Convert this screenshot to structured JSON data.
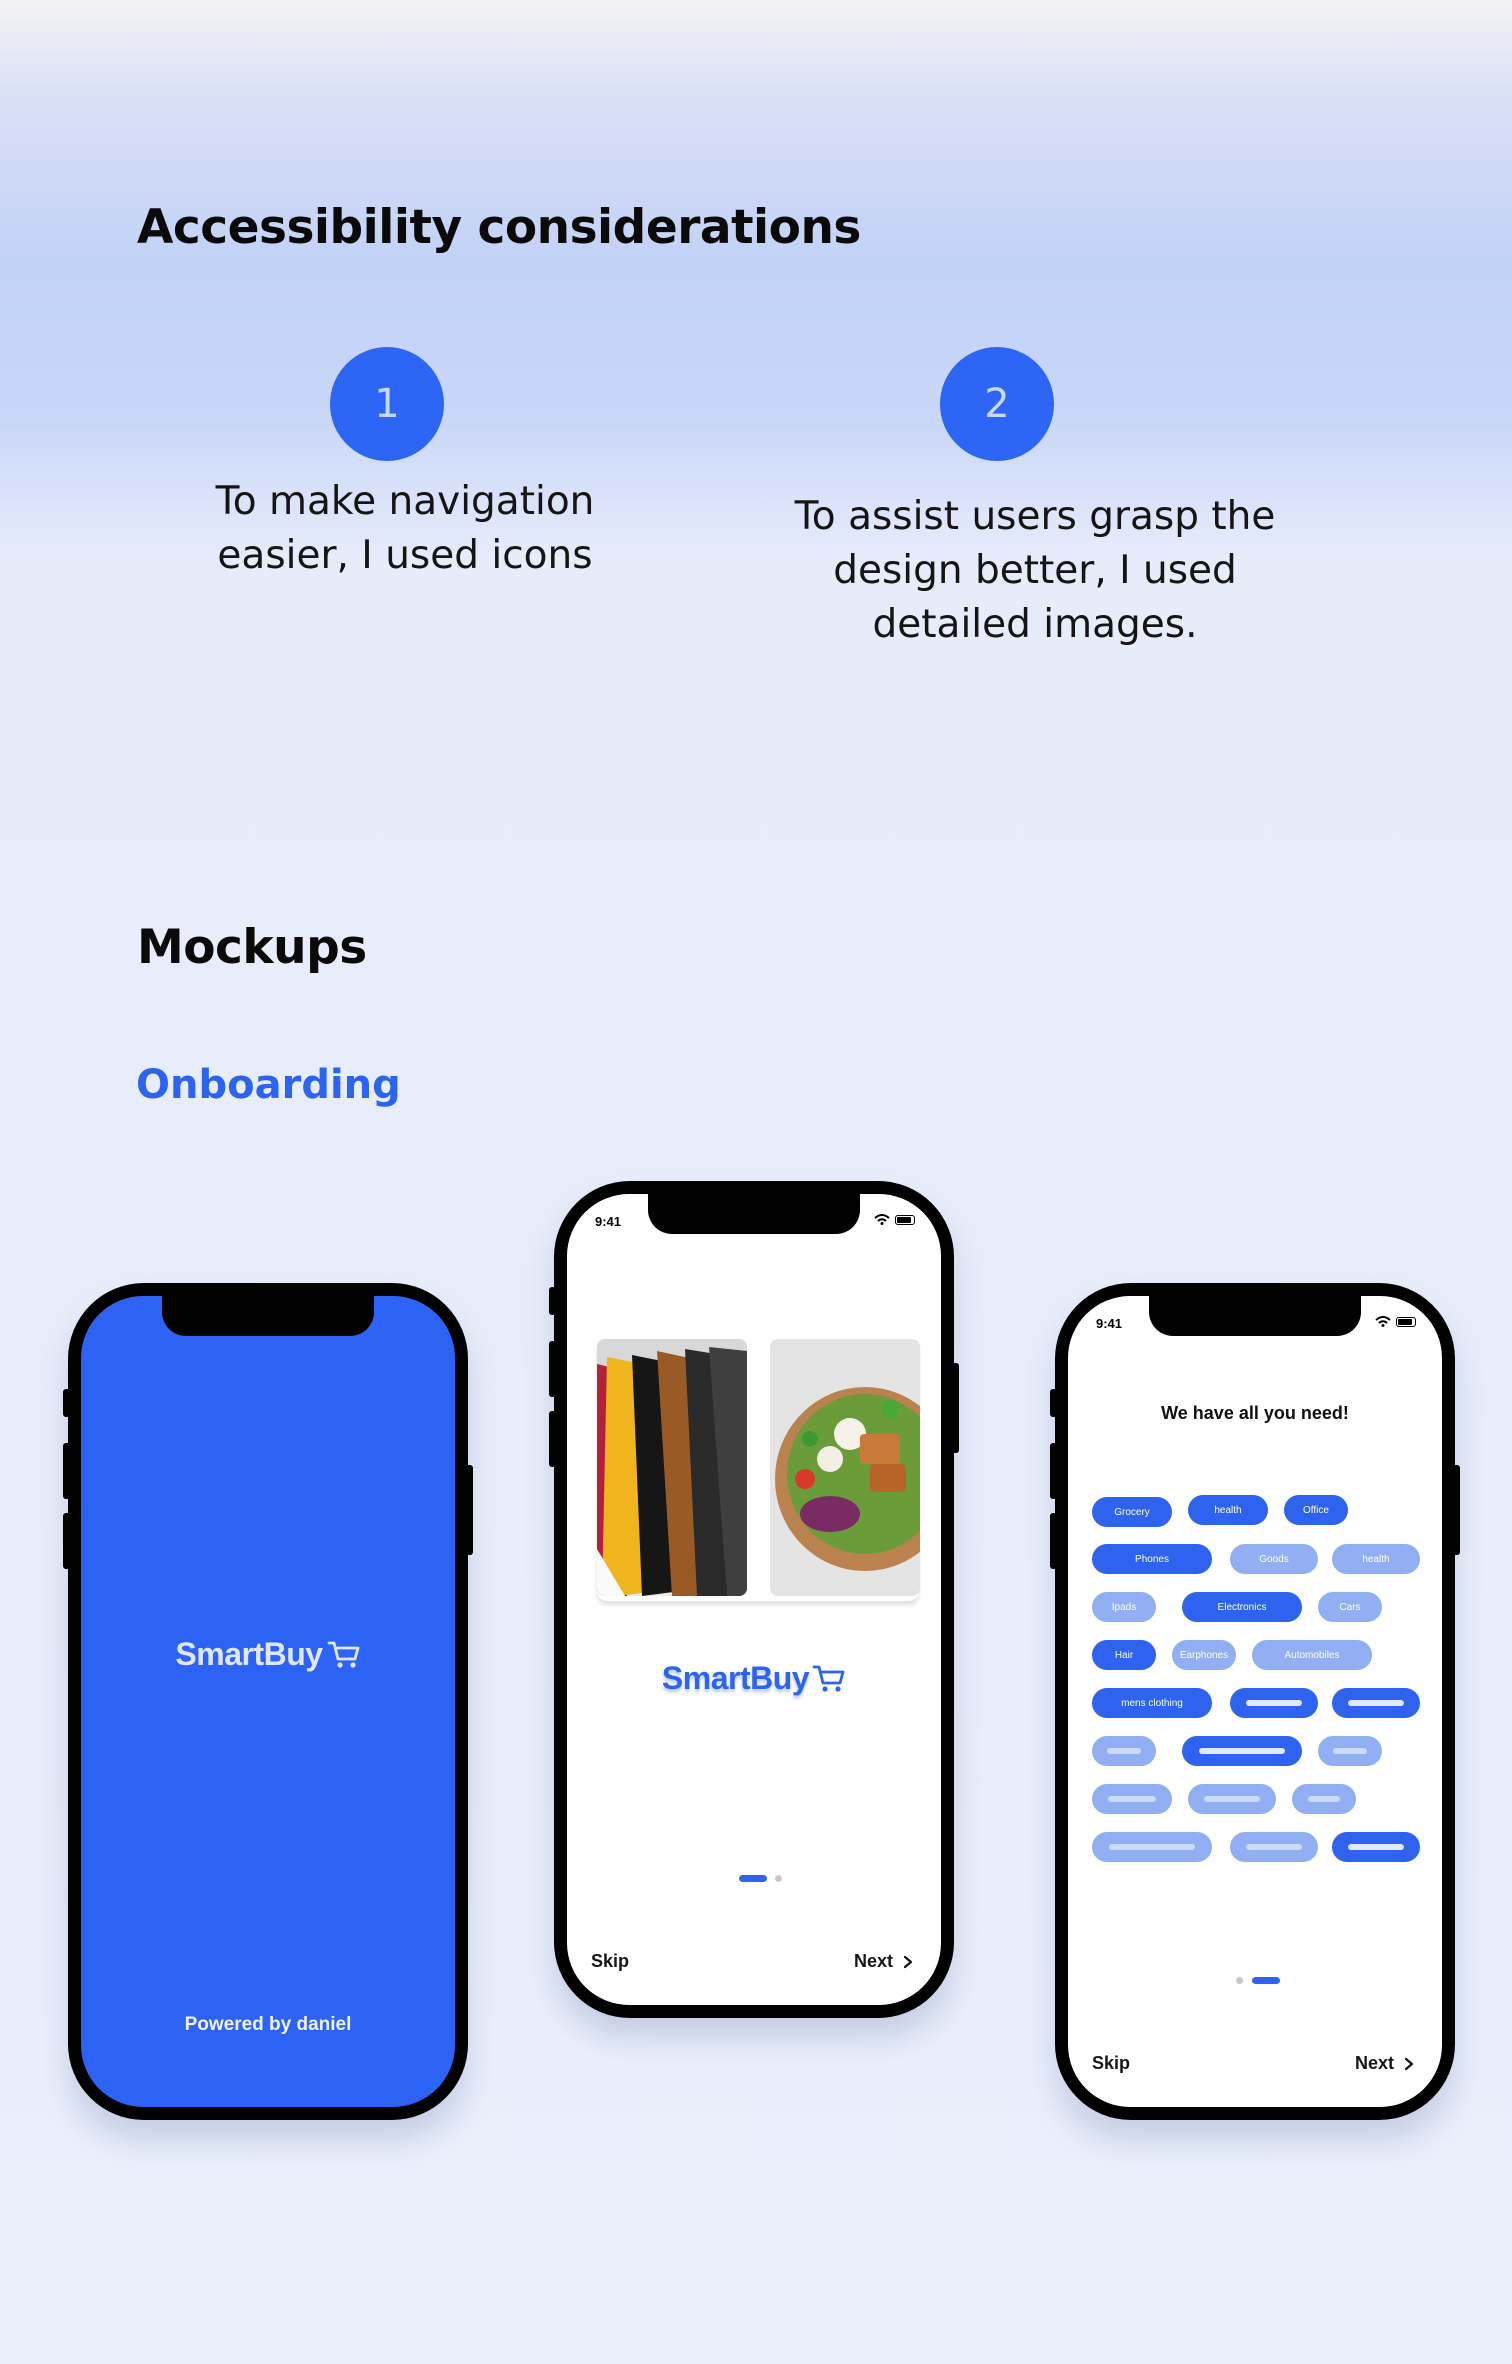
{
  "accessibility": {
    "heading": "Accessibility considerations",
    "items": [
      {
        "number": "1",
        "text_line1": "To make navigation",
        "text_line2": "easier, I used icons"
      },
      {
        "number": "2",
        "text_line1": "To assist users grasp the",
        "text_line2": "design better, I used",
        "text_line3": "detailed images."
      }
    ]
  },
  "mockups": {
    "heading": "Mockups",
    "subheading": "Onboarding"
  },
  "phone1": {
    "logo": "SmartBuy",
    "footer": "Powered by daniel",
    "bg_color": "#2d63f5"
  },
  "phone2": {
    "time": "9:41",
    "logo": "SmartBuy",
    "skip": "Skip",
    "next": "Next"
  },
  "phone3": {
    "time": "9:41",
    "title": "We have all you need!",
    "chips": [
      "Grocery",
      "health",
      "Office",
      "Phones",
      "Goods",
      "health",
      "Ipads",
      "Electronics",
      "Cars",
      "Hair",
      "Earphones",
      "Automobiles",
      "mens clothing"
    ],
    "skip": "Skip",
    "next": "Next"
  },
  "colors": {
    "accent": "#2d65f4",
    "chip_light": "#93aff4"
  }
}
